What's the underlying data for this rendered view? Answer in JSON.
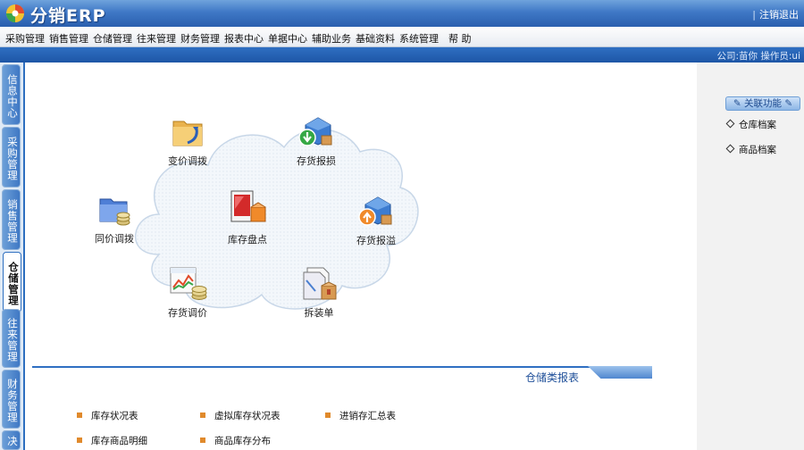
{
  "header": {
    "app_title": "分销ERP",
    "logout": "注销退出"
  },
  "menu": [
    "采购管理",
    "销售管理",
    "仓储管理",
    "往来管理",
    "财务管理",
    "报表中心",
    "单据中心",
    "辅助业务",
    "基础资料",
    "系统管理",
    "帮 助"
  ],
  "infobar": {
    "text": "公司:苗你   操作员:ui"
  },
  "sidebar": {
    "tabs": [
      {
        "label": "信息中心",
        "active": false
      },
      {
        "label": "采购管理",
        "active": false
      },
      {
        "label": "销售管理",
        "active": false
      },
      {
        "label": "仓储管理",
        "active": true
      },
      {
        "label": "往来管理",
        "active": false
      },
      {
        "label": "财务管理",
        "active": false
      },
      {
        "label": "决",
        "active": false
      }
    ]
  },
  "workflow": {
    "nodes": [
      {
        "label": "变价调拨",
        "icon": "folder-arrow-icon"
      },
      {
        "label": "存货报损",
        "icon": "warehouse-down-icon"
      },
      {
        "label": "同价调拨",
        "icon": "folder-coins-icon"
      },
      {
        "label": "库存盘点",
        "icon": "inventory-check-icon"
      },
      {
        "label": "存货报溢",
        "icon": "warehouse-up-icon"
      },
      {
        "label": "存货调价",
        "icon": "price-chart-icon"
      },
      {
        "label": "拆装单",
        "icon": "document-box-icon"
      }
    ]
  },
  "reports": {
    "title": "仓储类报表",
    "links": [
      "库存状况表",
      "虚拟库存状况表",
      "进销存汇总表",
      "库存商品明细",
      "商品库存分布"
    ]
  },
  "related": {
    "title": "关联功能",
    "items": [
      "仓库档案",
      "商品档案"
    ]
  },
  "colors": {
    "accent": "#2f6fc2",
    "bullet": "#e08a2c"
  }
}
